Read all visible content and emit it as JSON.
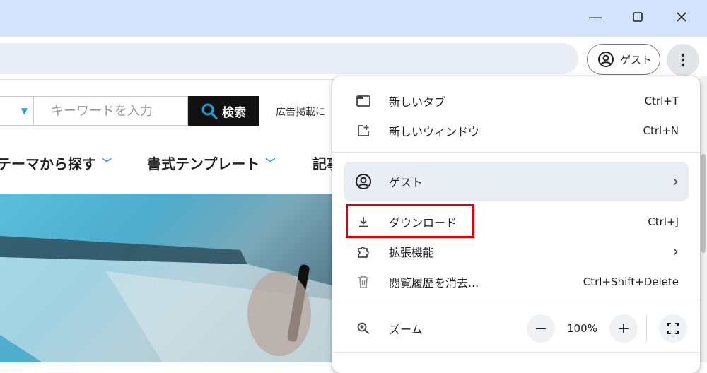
{
  "window": {
    "minimize_glyph": "—",
    "maximize_glyph": "☐",
    "close_glyph": "✕"
  },
  "toolbar": {
    "profile_label": "ゲスト"
  },
  "page": {
    "search_placeholder": "キーワードを入力",
    "search_button_label": "検索",
    "ad_text": "広告掲載に",
    "nav": [
      {
        "label": "テーマから探す"
      },
      {
        "label": "書式テンプレート"
      },
      {
        "label": "記事"
      }
    ]
  },
  "menu": {
    "new_tab": {
      "label": "新しいタブ",
      "shortcut": "Ctrl+T"
    },
    "new_window": {
      "label": "新しいウィンドウ",
      "shortcut": "Ctrl+N"
    },
    "guest": {
      "label": "ゲスト",
      "arrow": "›"
    },
    "downloads": {
      "label": "ダウンロード",
      "shortcut": "Ctrl+J"
    },
    "extensions": {
      "label": "拡張機能",
      "arrow": "›"
    },
    "clear_history": {
      "label": "閲覧履歴を消去...",
      "shortcut": "Ctrl+Shift+Delete"
    },
    "zoom": {
      "label": "ズーム",
      "minus": "−",
      "value": "100%",
      "plus": "+"
    }
  },
  "colors": {
    "titlebar": "#d3e3fd",
    "highlight": "#e00000",
    "accent": "#1aa0d8"
  }
}
